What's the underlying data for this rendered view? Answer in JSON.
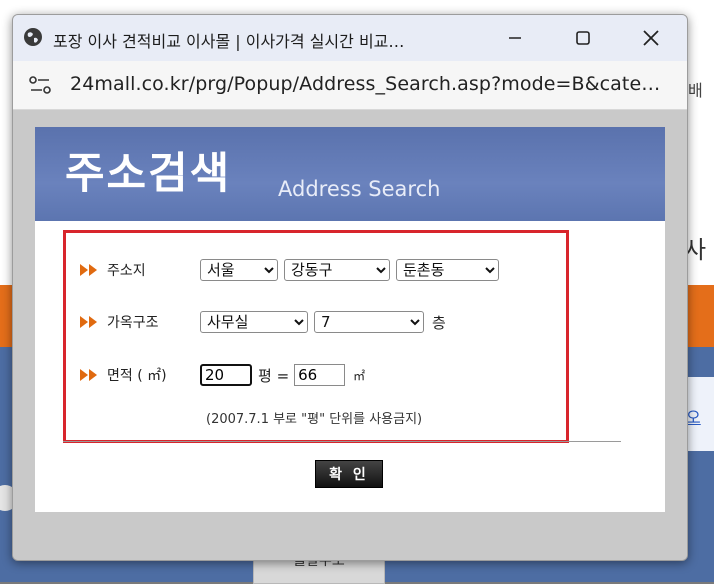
{
  "window": {
    "title": "포장 이사 견적비교 이사몰 | 이사가격 실시간 비교…",
    "url": "24mall.co.kr/prg/Popup/Address_Search.asp?mode=B&cate…"
  },
  "background": {
    "right_char": "사",
    "right_mini": "배",
    "right_link": "오",
    "bottom_tab": "출발주소"
  },
  "banner": {
    "title": "주소검색",
    "subtitle": "Address Search"
  },
  "form": {
    "address": {
      "label": "주소지",
      "city": "서울",
      "district": "강동구",
      "dong": "둔촌동"
    },
    "building": {
      "label": "가옥구조",
      "type": "사무실",
      "floor": "7",
      "floor_unit": "층"
    },
    "area": {
      "label": "면적 ( ㎡)",
      "pyeong_value": "20",
      "pyeong_unit": "평 =",
      "sqm_value": "66",
      "sqm_unit": "㎡"
    },
    "note": "(2007.7.1 부로 \"평\" 단위를 사용금지)"
  },
  "buttons": {
    "confirm": "확 인"
  },
  "colors": {
    "banner": "#6a82bd",
    "highlight_border": "#d8252c",
    "arrow": "#e06a10",
    "page_orange": "#e46e1a",
    "page_blue": "#4d6da3"
  }
}
